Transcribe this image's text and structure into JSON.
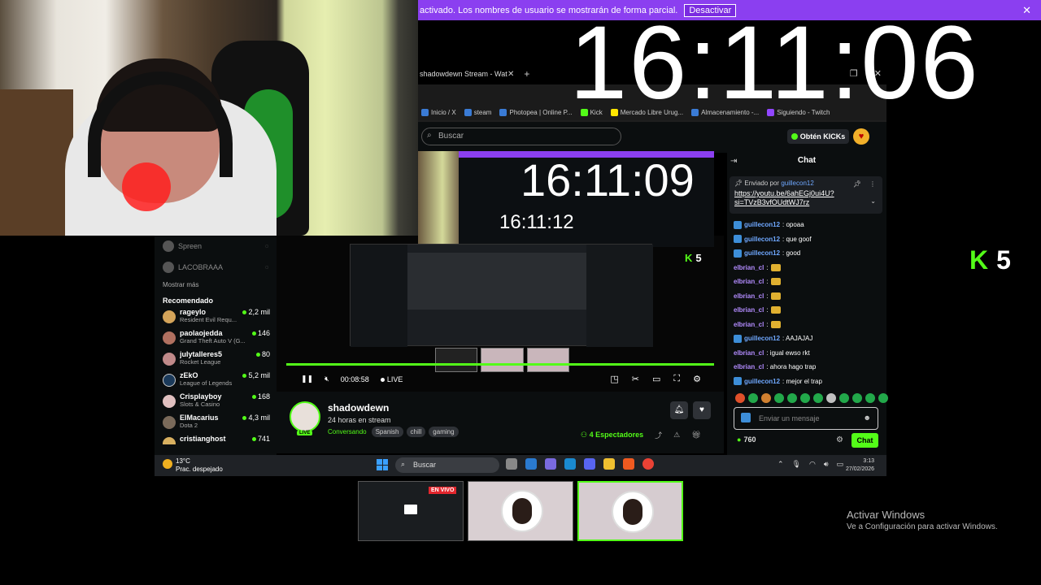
{
  "notice": {
    "text": "activado. Los nombres de usuario se mostrarán de forma parcial.",
    "button": "Desactivar",
    "close": "✕"
  },
  "big_clock": "16:11:06",
  "nested_clock_1": "16:11:09",
  "nested_clock_2": "16:11:12",
  "browser": {
    "tab_title": "shadowdewn Stream - Watch L",
    "tab_close": "✕",
    "new_tab": "+",
    "bookmarks": [
      "Inicio / X",
      "steam",
      "Photopea | Online P...",
      "Kick",
      "Mercado Libre Urug...",
      "Almacenamiento -...",
      "Siguiendo - Twitch"
    ]
  },
  "kick": {
    "search_placeholder": "Buscar",
    "get_kicks": "Obtén KICKs",
    "followed": [
      {
        "name": "Spreen"
      },
      {
        "name": "LACOBRAAA"
      }
    ],
    "show_more": "Mostrar más",
    "recommended_title": "Recomendado",
    "recommended": [
      {
        "name": "rageylo",
        "game": "Resident Evil Requ...",
        "viewers": "2,2 mil"
      },
      {
        "name": "paolaojedda",
        "game": "Grand Theft Auto V (G...",
        "viewers": "146"
      },
      {
        "name": "julytalleres5",
        "game": "Rocket League",
        "viewers": "80"
      },
      {
        "name": "zEkO",
        "game": "League of Legends",
        "viewers": "5,2 mil"
      },
      {
        "name": "Crisplayboy",
        "game": "Slots & Casino",
        "viewers": "168"
      },
      {
        "name": "ElMacarius",
        "game": "Dota 2",
        "viewers": "4,3 mil"
      },
      {
        "name": "cristianghost",
        "game": "",
        "viewers": "741"
      }
    ],
    "player": {
      "time": "00:08:58",
      "live": "LIVE",
      "kick_badge": "5"
    },
    "stream": {
      "name": "shadowdewn",
      "title": "24 horas en stream",
      "category": "Conversando",
      "tags": [
        "Spanish",
        "chill",
        "gaming"
      ],
      "live_badge": "LIVE",
      "viewers": "4 Espectadores"
    },
    "chat": {
      "title": "Chat",
      "pinned_by_label": "Enviado por",
      "pinned_by": "guillecon12",
      "pinned_link": "https://youtu.be/6ahEGj0ui4U?si=TVzB3vfOUdtWJ7rz",
      "messages": [
        {
          "user": "guillecon12",
          "text": ": opoaa",
          "color": "#6fa8ff",
          "badge": true
        },
        {
          "user": "guillecon12",
          "text": ": que goof",
          "color": "#6fa8ff",
          "badge": true
        },
        {
          "user": "guillecon12",
          "text": ": good",
          "color": "#6fa8ff",
          "badge": true
        },
        {
          "user": "elbrian_cl",
          "text": ":",
          "color": "#b38cff",
          "badge": false
        },
        {
          "user": "elbrian_cl",
          "text": ":",
          "color": "#b38cff",
          "badge": false
        },
        {
          "user": "elbrian_cl",
          "text": ":",
          "color": "#b38cff",
          "badge": false
        },
        {
          "user": "elbrian_cl",
          "text": ":",
          "color": "#b38cff",
          "badge": false
        },
        {
          "user": "elbrian_cl",
          "text": ":",
          "color": "#b38cff",
          "badge": false
        },
        {
          "user": "guillecon12",
          "text": ": AAJAJAJ",
          "color": "#6fa8ff",
          "badge": true
        },
        {
          "user": "elbrian_cl",
          "text": ": igual ewso rkt",
          "color": "#b38cff",
          "badge": false
        },
        {
          "user": "elbrian_cl",
          "text": ": ahora hago trap",
          "color": "#b38cff",
          "badge": false
        },
        {
          "user": "guillecon12",
          "text": ": mejor el trap",
          "color": "#6fa8ff",
          "badge": true
        }
      ],
      "input_placeholder": "Enviar un mensaje",
      "points": "760",
      "send": "Chat"
    }
  },
  "taskbar": {
    "temp": "13°C",
    "weather": "Prac. despejado",
    "search": "Buscar",
    "time": "3:13",
    "date": "27/02/2026"
  },
  "thumbs": {
    "live_label": "EN VIVO"
  },
  "kick_badge_large": "5",
  "activate_windows": {
    "title": "Activar Windows",
    "subtitle": "Ve a Configuración para activar Windows."
  },
  "colors": {
    "kick_green": "#53fc18",
    "notice_purple": "#8b3ff0"
  }
}
